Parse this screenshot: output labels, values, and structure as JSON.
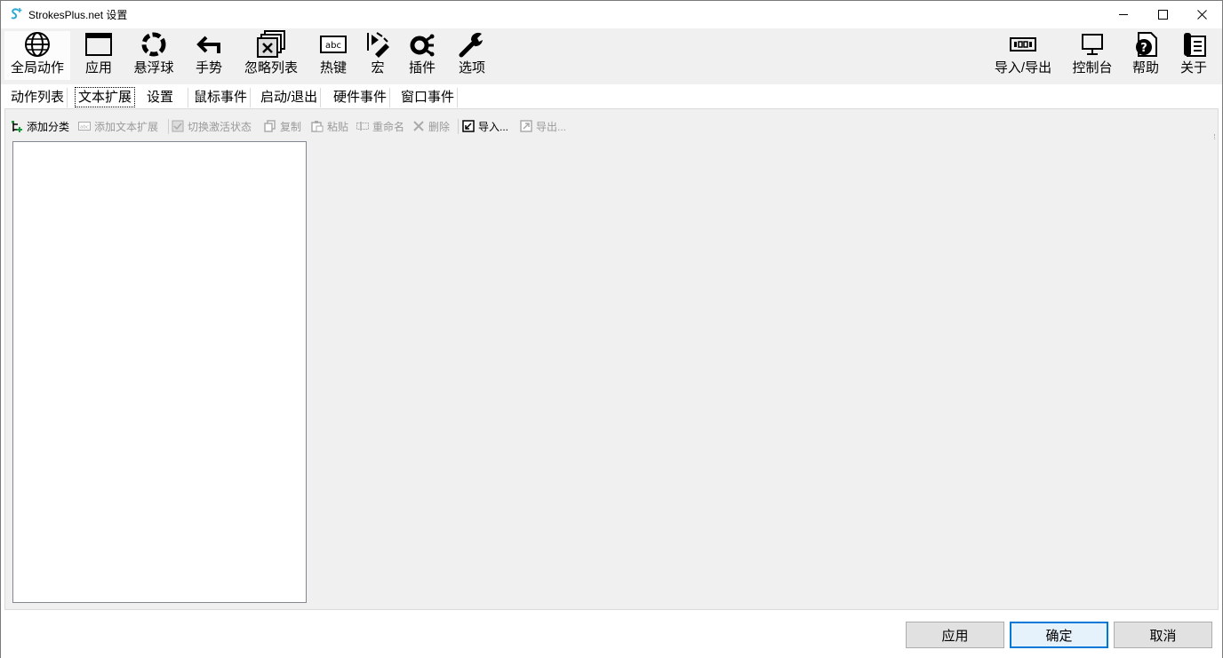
{
  "window": {
    "title": "StrokesPlus.net 设置"
  },
  "main_toolbar": {
    "left": [
      {
        "label": "全局动作",
        "icon": "globe-icon"
      },
      {
        "label": "应用",
        "icon": "app-window-icon"
      },
      {
        "label": "悬浮球",
        "icon": "floating-ball-icon"
      },
      {
        "label": "手势",
        "icon": "gesture-arrow-icon"
      },
      {
        "label": "忽略列表",
        "icon": "ignore-list-icon"
      },
      {
        "label": "热键",
        "icon": "hotkey-abc-icon"
      },
      {
        "label": "宏",
        "icon": "macro-icon"
      },
      {
        "label": "插件",
        "icon": "plugin-icon"
      },
      {
        "label": "选项",
        "icon": "wrench-icon"
      }
    ],
    "right": [
      {
        "label": "导入/导出",
        "icon": "import-export-icon"
      },
      {
        "label": "控制台",
        "icon": "monitor-icon"
      },
      {
        "label": "帮助",
        "icon": "help-icon"
      },
      {
        "label": "关于",
        "icon": "about-icon"
      }
    ]
  },
  "sub_tabs": [
    "动作列表",
    "文本扩展",
    "设置",
    "鼠标事件",
    "启动/退出",
    "硬件事件",
    "窗口事件"
  ],
  "active_sub_tab": "文本扩展",
  "inner_toolbar": {
    "add_category": "添加分类",
    "add_text_expansion": "添加文本扩展",
    "toggle_active": "切换激活状态",
    "copy": "复制",
    "paste": "粘贴",
    "rename": "重命名",
    "delete": "删除",
    "import": "导入...",
    "export": "导出..."
  },
  "footer": {
    "apply": "应用",
    "ok": "确定",
    "cancel": "取消"
  }
}
